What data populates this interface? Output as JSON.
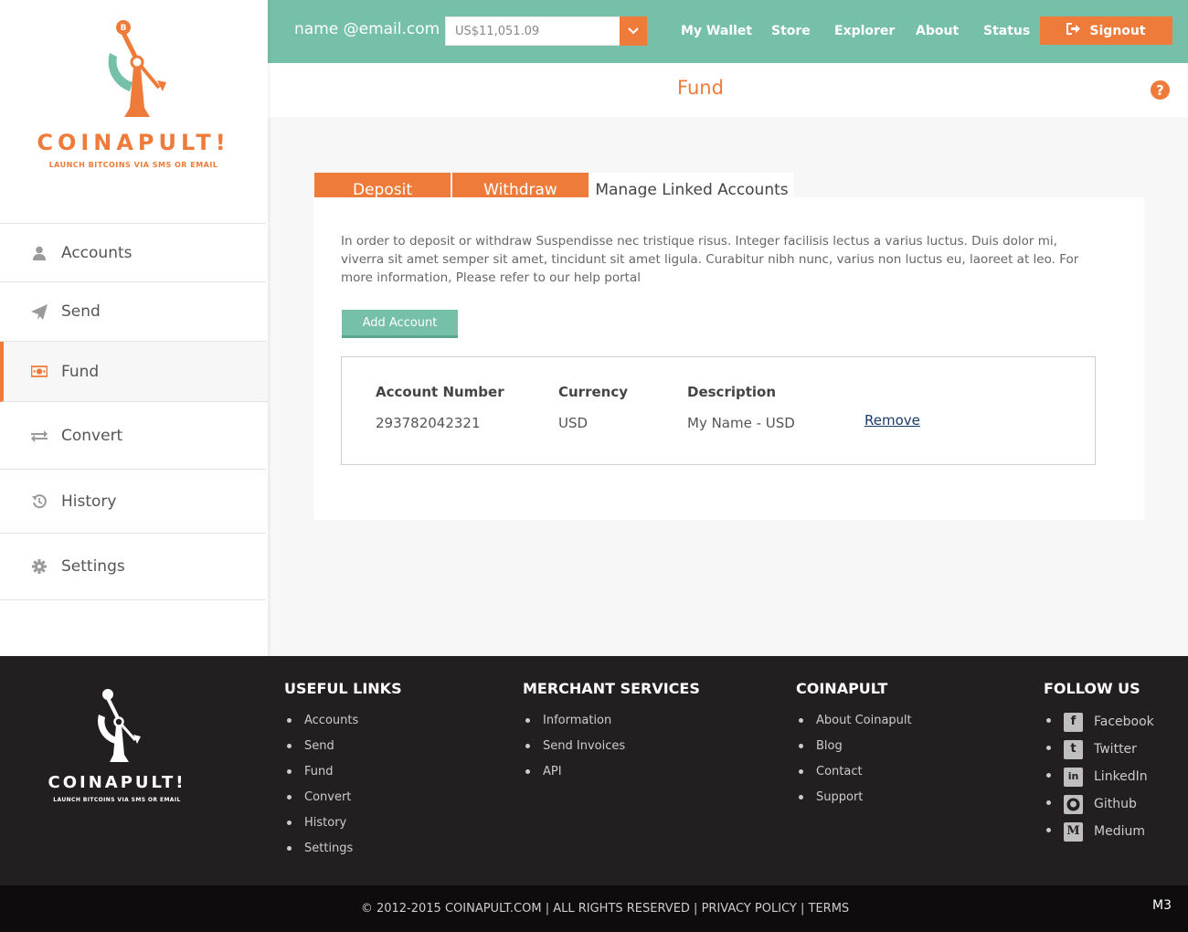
{
  "brand": {
    "name": "COINAPULT!",
    "tagline": "LAUNCH BITCOINS VIA SMS OR EMAIL"
  },
  "sidebar": {
    "items": [
      {
        "label": "Accounts",
        "icon": "user-icon"
      },
      {
        "label": "Send",
        "icon": "paper-plane-icon"
      },
      {
        "label": "Fund",
        "icon": "money-icon",
        "active": true
      },
      {
        "label": "Convert",
        "icon": "exchange-icon"
      },
      {
        "label": "History",
        "icon": "history-icon"
      },
      {
        "label": "Settings",
        "icon": "gear-icon"
      }
    ]
  },
  "header": {
    "email": "name @email.com",
    "balance": "US$11,051.09",
    "nav": [
      "My Wallet",
      "Store",
      "Explorer",
      "About",
      "Status"
    ],
    "signout": "Signout"
  },
  "page": {
    "title": "Fund",
    "help": "?"
  },
  "tabs": [
    {
      "label": "Deposit"
    },
    {
      "label": "Withdraw"
    },
    {
      "label": "Manage Linked Accounts",
      "active": true
    }
  ],
  "panel": {
    "intro": "In order to deposit or withdraw Suspendisse nec tristique risus. Integer facilisis lectus a varius luctus. Duis dolor mi, viverra sit amet semper sit amet, tincidunt sit amet ligula. Curabitur nibh nunc, varius non luctus eu, laoreet at leo. For more information, Please refer to our help portal",
    "add_account": "Add Account",
    "table": {
      "headers": [
        "Account Number",
        "Currency",
        "Description"
      ],
      "rows": [
        {
          "account_number": "293782042321",
          "currency": "USD",
          "description": "My Name - USD",
          "action": "Remove"
        }
      ]
    }
  },
  "footer": {
    "useful_links": {
      "title": "USEFUL LINKS",
      "items": [
        "Accounts",
        "Send",
        "Fund",
        "Convert",
        "History",
        "Settings"
      ]
    },
    "merchant": {
      "title": "MERCHANT SERVICES",
      "items": [
        "Information",
        "Send Invoices",
        "API"
      ]
    },
    "coinapult": {
      "title": "COINAPULT",
      "items": [
        "About Coinapult",
        "Blog",
        "Contact",
        "Support"
      ]
    },
    "follow": {
      "title": "FOLLOW US",
      "items": [
        "Facebook",
        "Twitter",
        "LinkedIn",
        "Github",
        "Medium"
      ]
    },
    "copyright": "© 2012-2015 COINAPULT.COM | ALL RIGHTS RESERVED | PRIVACY POLICY | TERMS",
    "version": "M3"
  },
  "colors": {
    "accent": "#ee7b3a",
    "teal": "#76bfa9",
    "footer": "#231f20"
  }
}
